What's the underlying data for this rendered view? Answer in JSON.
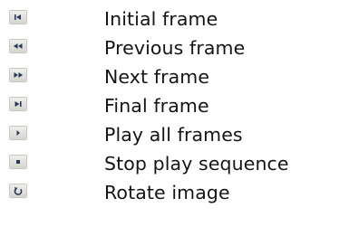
{
  "legend": {
    "items": [
      {
        "icon": "first-frame-icon",
        "label": "Initial frame"
      },
      {
        "icon": "previous-frame-icon",
        "label": "Previous frame"
      },
      {
        "icon": "next-frame-icon",
        "label": "Next frame"
      },
      {
        "icon": "last-frame-icon",
        "label": "Final frame"
      },
      {
        "icon": "play-icon",
        "label": "Play all frames"
      },
      {
        "icon": "stop-icon",
        "label": "Stop play sequence"
      },
      {
        "icon": "rotate-icon",
        "label": "Rotate image"
      }
    ]
  },
  "colors": {
    "icon_glyph": "#2a3a55",
    "icon_face": "#e3e3de",
    "text": "#141414",
    "background": "#ffffff"
  }
}
